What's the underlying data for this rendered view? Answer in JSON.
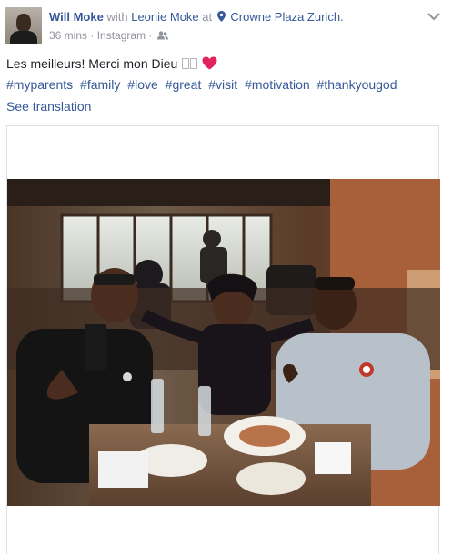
{
  "post": {
    "author": "Will Moke",
    "with_word": "with",
    "tagged": "Leonie Moke",
    "at_word": "at",
    "location": "Crowne Plaza Zurich.",
    "time": "36 mins",
    "separator": "·",
    "source": "Instagram",
    "separator2": "·",
    "text": "Les meilleurs! Merci mon Dieu",
    "hashtags": [
      "#myparents",
      "#family",
      "#love",
      "#great",
      "#visit",
      "#motivation",
      "#thankyougod"
    ],
    "see_translation": "See translation"
  },
  "icons": {
    "avatar": "avatar",
    "location": "map-pin-icon",
    "audience": "friends-icon",
    "options": "chevron-down-icon",
    "emoji": "red-heart-icon"
  },
  "colors": {
    "link": "#365899",
    "meta": "#90949c",
    "text": "#1d2129",
    "heart": "#e0245e"
  }
}
